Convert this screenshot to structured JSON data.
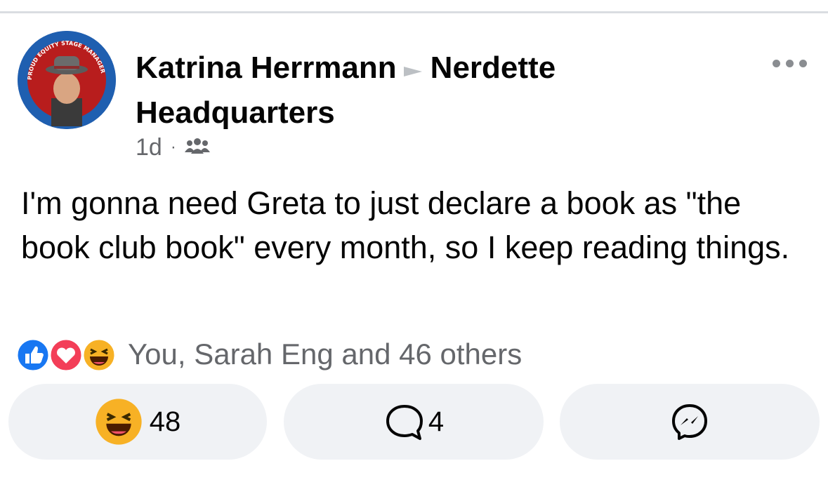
{
  "post": {
    "author": "Katrina Herrmann",
    "group": "Nerdette Headquarters",
    "time": "1d",
    "dot": "·",
    "audience_icon": "group-icon",
    "text": "I'm gonna need Greta to just declare a book as \"the book club book\" every month, so I keep reading things.",
    "avatar_badge_text": "PROUD EQUITY STAGE MANAGER"
  },
  "reactions": {
    "icons": [
      "like-icon",
      "love-icon",
      "haha-icon"
    ],
    "summary": "You, Sarah Eng and 46 others"
  },
  "actions": {
    "react_count": "48",
    "comment_count": "4",
    "share_icon": "messenger-icon"
  },
  "colors": {
    "like": "#1877f2",
    "love": "#f33e58",
    "haha": "#f7b125",
    "button_bg": "#f0f2f5",
    "meta": "#65676b"
  }
}
